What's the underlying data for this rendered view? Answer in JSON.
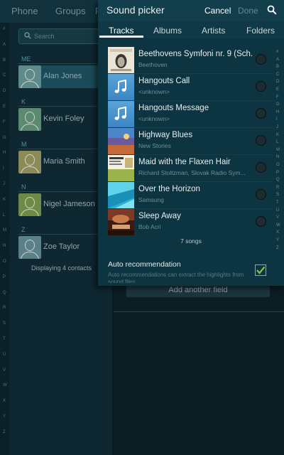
{
  "background": {
    "tabs": [
      {
        "label": "Phone"
      },
      {
        "label": "Groups"
      },
      {
        "label": "F"
      }
    ],
    "search_placeholder": "Search",
    "index_letters": [
      "#",
      "A",
      "B",
      "C",
      "D",
      "E",
      "F",
      "G",
      "H",
      "I",
      "J",
      "K",
      "L",
      "M",
      "N",
      "O",
      "P",
      "Q",
      "R",
      "S",
      "T",
      "U",
      "V",
      "W",
      "X",
      "Y",
      "Z"
    ],
    "sections": [
      "ME",
      "K",
      "M",
      "N",
      "Z"
    ],
    "contacts": [
      {
        "name": "Alan Jones",
        "avatar_color": "#5f8a8a"
      },
      {
        "name": "Kevin Foley",
        "avatar_color": "#5c8a70"
      },
      {
        "name": "Maria Smith",
        "avatar_color": "#8a8b58"
      },
      {
        "name": "Nigel Jameson",
        "avatar_color": "#6f8a48"
      },
      {
        "name": "Zoe Taylor",
        "avatar_color": "#5a8088"
      }
    ],
    "displaying_text": "Displaying 4 contacts",
    "add_field_label": "Add another field"
  },
  "dialog": {
    "title": "Sound picker",
    "cancel_label": "Cancel",
    "done_label": "Done",
    "tabs": [
      {
        "label": "Tracks",
        "selected": true
      },
      {
        "label": "Albums",
        "selected": false
      },
      {
        "label": "Artists",
        "selected": false
      },
      {
        "label": "Folders",
        "selected": false
      }
    ],
    "tracks": [
      {
        "title": "Beethovens Symfoni nr. 9 (Sch...",
        "subtitle": "Beethoven",
        "art": "beethoven"
      },
      {
        "title": "Hangouts Call",
        "subtitle": "<unknown>",
        "art": "music-note"
      },
      {
        "title": "Hangouts Message",
        "subtitle": "<unknown>",
        "art": "music-note"
      },
      {
        "title": "Highway Blues",
        "subtitle": "New Stories",
        "art": "highway"
      },
      {
        "title": "Maid with the Flaxen Hair",
        "subtitle": "Richard Stoltzman, Slovak Radio Sym...",
        "art": "flaxen"
      },
      {
        "title": "Over the Horizon",
        "subtitle": "Samsung",
        "art": "horizon"
      },
      {
        "title": "Sleep Away",
        "subtitle": "Bob Acri",
        "art": "sleepaway"
      }
    ],
    "songs_count": "7 songs",
    "index_letters": [
      "#",
      "A",
      "B",
      "C",
      "D",
      "E",
      "F",
      "G",
      "H",
      "I",
      "J",
      "K",
      "L",
      "M",
      "N",
      "O",
      "P",
      "Q",
      "R",
      "S",
      "T",
      "U",
      "V",
      "W",
      "X",
      "Y",
      "Z"
    ],
    "auto_recommendation": {
      "label": "Auto recommendation",
      "description": "Auto recommendations can extract the highlights from sound files.",
      "checked": true
    },
    "accent_color": "#8bc34a"
  }
}
